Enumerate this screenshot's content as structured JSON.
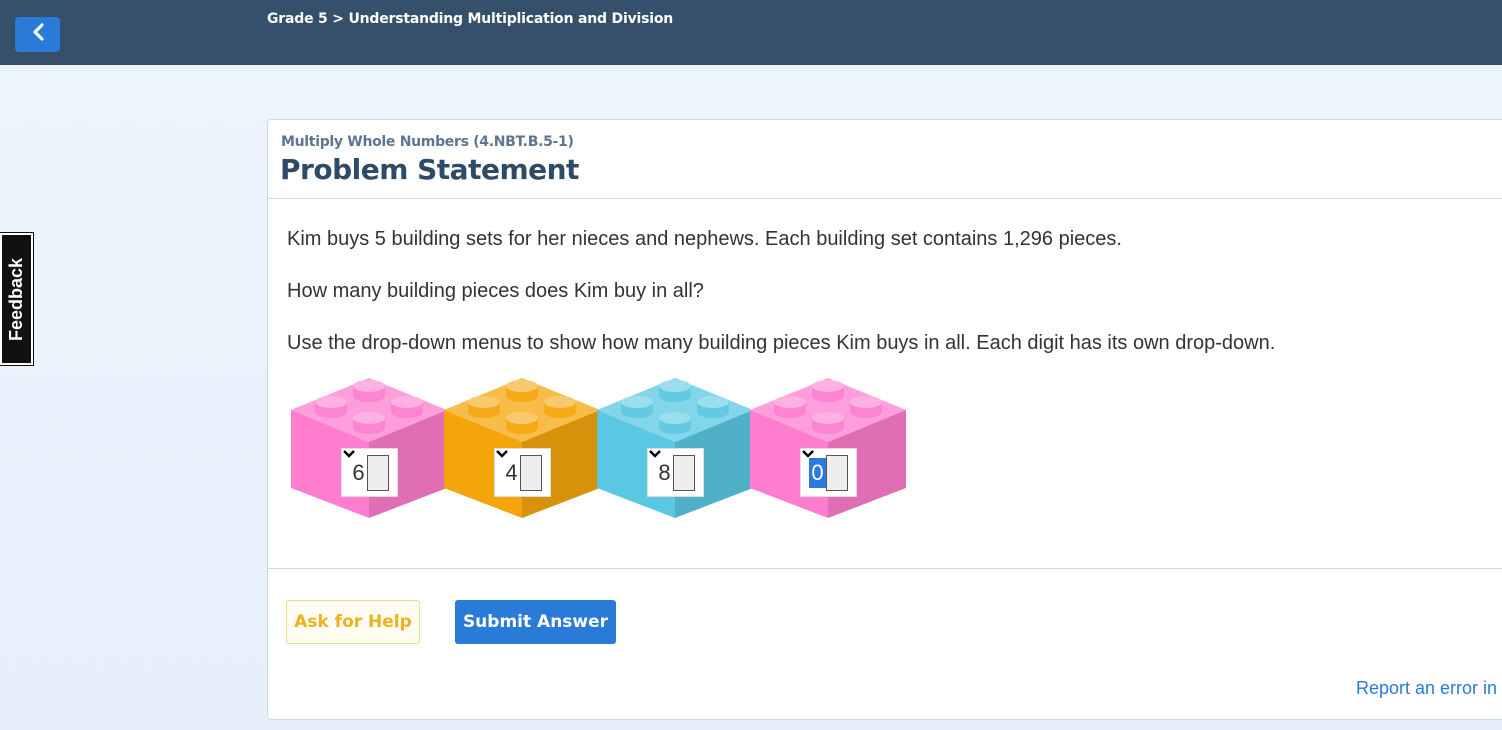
{
  "header": {
    "back_icon": "chevron-left-icon",
    "breadcrumb": "Grade 5 > Understanding Multiplication and Division"
  },
  "feedback": {
    "label": "Feedback"
  },
  "problem": {
    "standard": "Multiply Whole Numbers (4.NBT.B.5-1)",
    "title": "Problem Statement",
    "paragraphs": [
      "Kim buys 5 building sets for her nieces and nephews. Each building set contains 1,296 pieces.",
      "How many building pieces does Kim buy in all?",
      "Use the drop-down menus to show how many building pieces Kim buys in all. Each digit has its own drop-down."
    ],
    "digits": [
      {
        "value": "6",
        "color": "#ff7dce"
      },
      {
        "value": "4",
        "color": "#f5a50c"
      },
      {
        "value": "8",
        "color": "#5ac8e2"
      },
      {
        "value": "0",
        "color": "#ff7dce"
      }
    ]
  },
  "actions": {
    "help_label": "Ask for Help",
    "submit_label": "Submit Answer",
    "report_label": "Report an error in"
  },
  "colors": {
    "topbar": "#36506b",
    "accent": "#2a7bd8",
    "help": "#f0b020"
  }
}
